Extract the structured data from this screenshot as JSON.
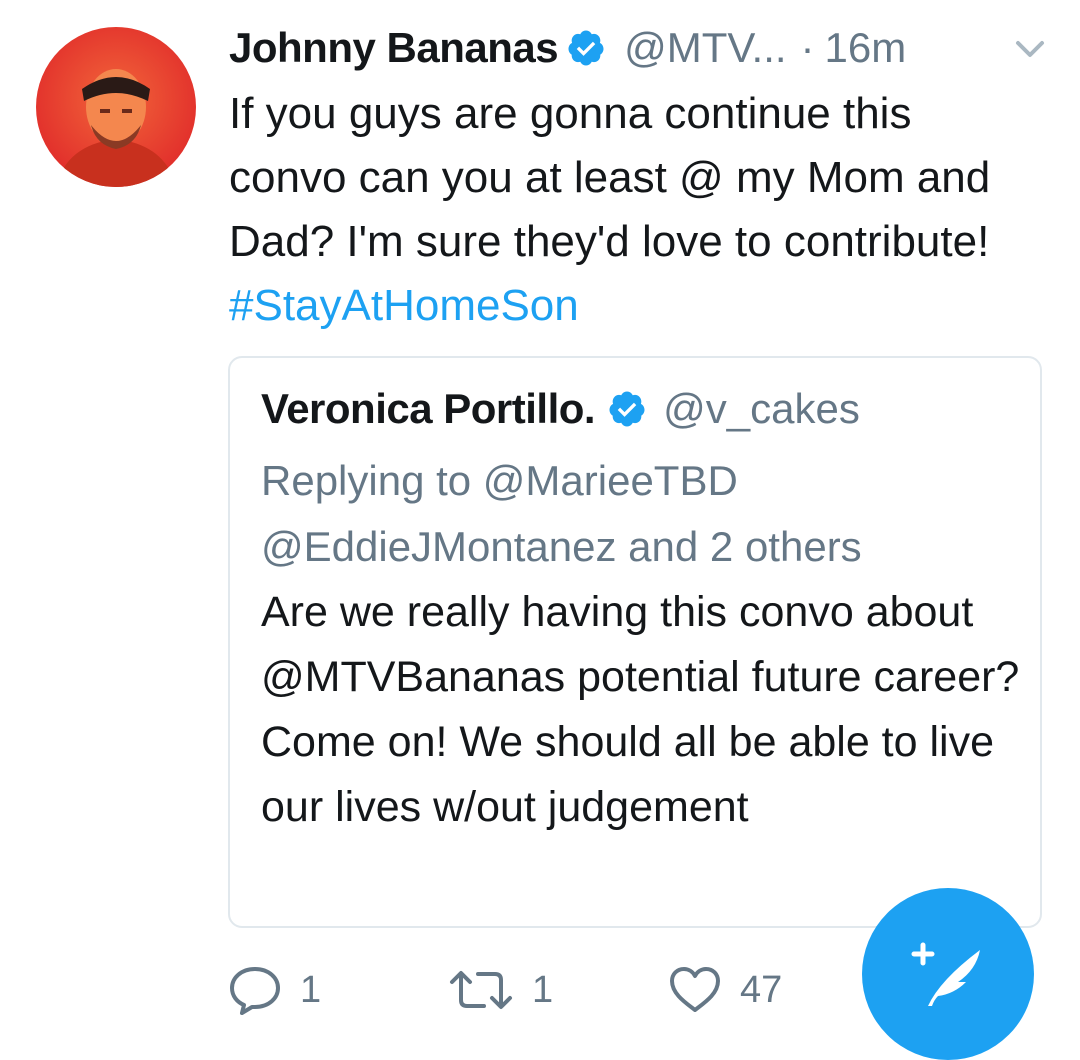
{
  "tweet": {
    "display_name": "Johnny Bananas",
    "handle": "@MTV...",
    "separator": "·",
    "timestamp": "16m",
    "text": "If you guys are gonna continue this convo can you at least @ my Mom and Dad? I'm sure they'd love to contribute!",
    "hashtag": "#StayAtHomeSon"
  },
  "quoted_tweet": {
    "display_name": "Veronica Portillo.",
    "handle": "@v_cakes",
    "reply_line1": "Replying to @MarieeTBD",
    "reply_line2": "@EddieJMontanez and 2 others",
    "text": "Are we really having this convo about @MTVBananas potential future career? Come on!  We should all be able to live our lives w/out judgement"
  },
  "actions": {
    "reply_count": "1",
    "retweet_count": "1",
    "like_count": "47"
  },
  "icons": {
    "avatar": "profile-photo",
    "verified": "verified-badge-icon",
    "chevron": "chevron-down-icon",
    "reply": "reply-icon",
    "retweet": "retweet-icon",
    "like": "heart-icon",
    "compose": "compose-tweet-icon"
  },
  "colors": {
    "brand_blue": "#1da1f2",
    "muted_text": "#657786",
    "text": "#14171a",
    "avatar_tint": "#e8402c"
  }
}
